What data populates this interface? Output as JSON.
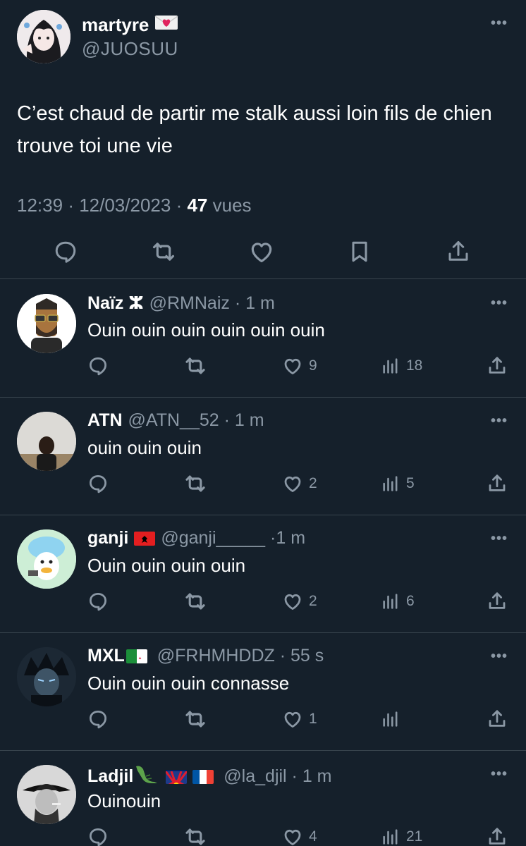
{
  "main_tweet": {
    "display_name": "martyre",
    "name_emoji": "💌",
    "handle": "@JUOSUU",
    "text": "C’est chaud de partir me stalk aussi loin fils de chien trouve toi une vie",
    "time": "12:39",
    "date": "12/03/2023",
    "views_count": "47",
    "views_label": "vues",
    "more": "•••"
  },
  "replies": [
    {
      "name": "Naïz ⵣ",
      "handle": "@RMNaiz",
      "age": "1 m",
      "text": "Ouin ouin ouin ouin ouin ouin",
      "likes": "9",
      "views": "18"
    },
    {
      "name": "ATN",
      "handle": "@ATN__52",
      "age": "1 m",
      "text": "ouin ouin ouin",
      "likes": "2",
      "views": "5"
    },
    {
      "name": "ganji",
      "handle": "@ganji_____",
      "age": "1 m",
      "text": "Ouin ouin ouin ouin",
      "likes": "2",
      "views": "6"
    },
    {
      "name": "MXL",
      "handle": "@FRHMHDDZ",
      "age": "55 s",
      "text": "Ouin ouin ouin connasse",
      "likes": "1",
      "views": ""
    },
    {
      "name": "Ladjil",
      "handle": "@la_djil",
      "age": "1 m",
      "text": "Ouinouin",
      "likes": "4",
      "views": "21"
    }
  ],
  "icons": {
    "reply": "reply-icon",
    "retweet": "retweet-icon",
    "like": "like-icon",
    "bookmark": "bookmark-icon",
    "share": "share-icon",
    "views": "views-icon",
    "more": "more-icon"
  },
  "colors": {
    "background": "#15202b",
    "text": "#ffffff",
    "secondary": "#8b98a5",
    "divider": "#38444d"
  }
}
